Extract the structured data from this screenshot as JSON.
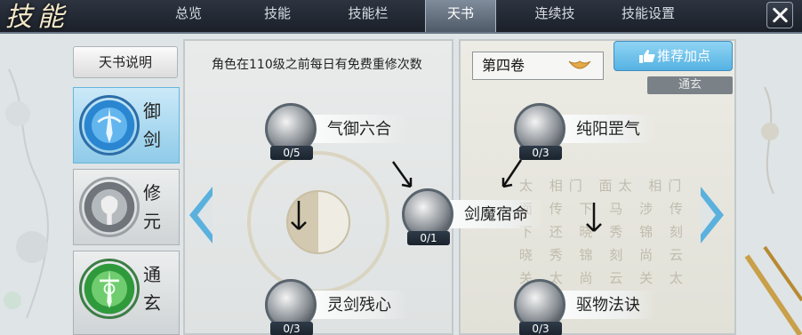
{
  "header": {
    "logo_text": "技能",
    "tabs": [
      {
        "label": "总览",
        "active": false
      },
      {
        "label": "技能",
        "active": false
      },
      {
        "label": "技能栏",
        "active": false
      },
      {
        "label": "天书",
        "active": true
      },
      {
        "label": "连续技",
        "active": false
      },
      {
        "label": "技能设置",
        "active": false
      }
    ]
  },
  "sidebar": {
    "desc_label": "天书说明",
    "books": [
      {
        "label": "御剑",
        "active": true,
        "color": "#2f8fd8",
        "icon": "sword-emblem-icon"
      },
      {
        "label": "修元",
        "active": false,
        "color": "#7d8388",
        "icon": "yuan-emblem-icon"
      },
      {
        "label": "通玄",
        "active": false,
        "color": "#2f9a3c",
        "icon": "tongxuan-emblem-icon"
      }
    ]
  },
  "main": {
    "notice": "角色在110级之前每日有免费重修次数",
    "volume_label": "第四卷",
    "recommend_label": "推荐加点",
    "school_tag": "通玄",
    "calligraphy": "太 相门 面太 相门 面 传 下 马 涉 传 下 还 晓 秀 锦 刻 晓 秀 锦 刻 尚 云 关 太 尚 云 关 太 恩 亦 恩 亦"
  },
  "skills": {
    "qiyu": {
      "name": "气御六合",
      "count": "0/5"
    },
    "lingjian": {
      "name": "灵剑残心",
      "count": "0/3"
    },
    "jianmo": {
      "name": "剑魔宿命",
      "count": "0/1"
    },
    "chunyang": {
      "name": "纯阳罡气",
      "count": "0/3"
    },
    "quwu": {
      "name": "驱物法诀",
      "count": "0/3"
    }
  },
  "colors": {
    "accent_blue": "#5ab1dd",
    "active_tab": "#6c7a89",
    "count_badge": "#1f2833"
  }
}
